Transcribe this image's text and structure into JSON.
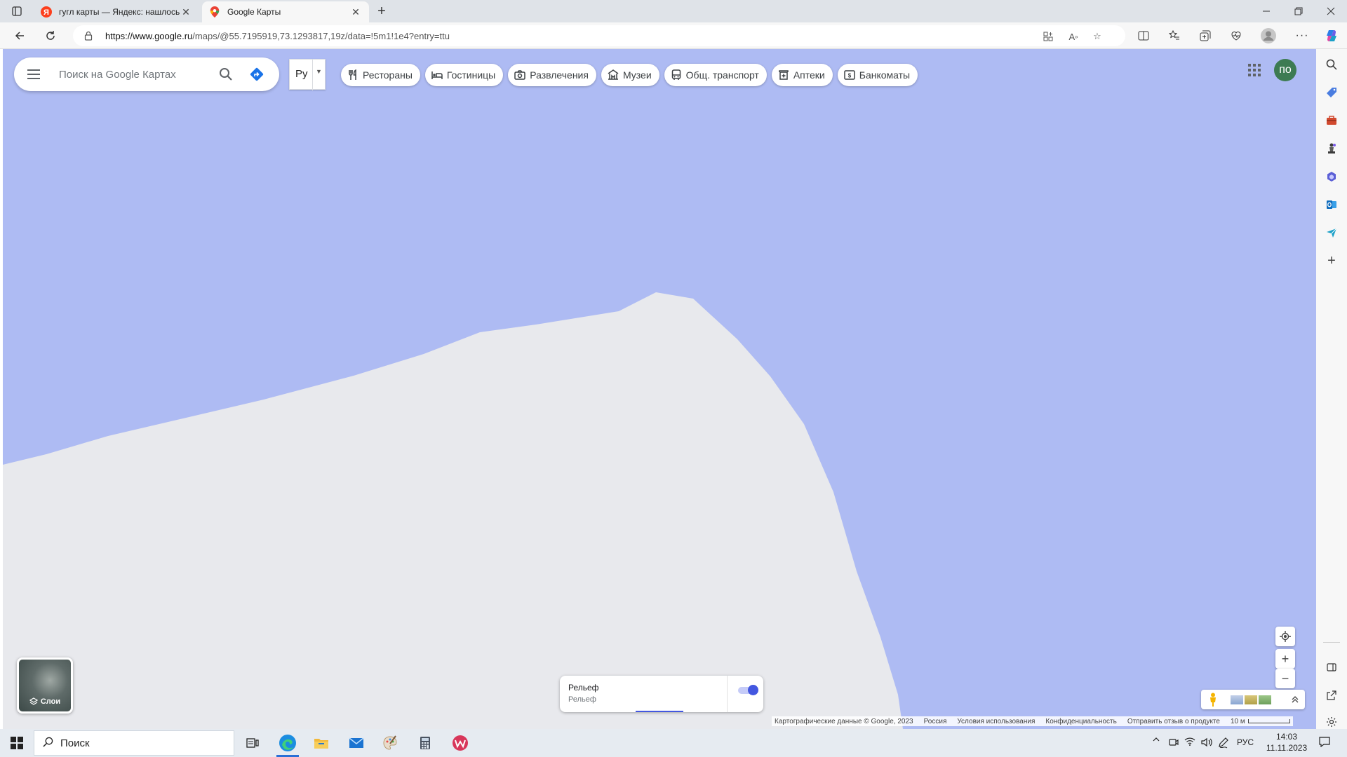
{
  "browser": {
    "tabs": [
      {
        "title": "гугл карты — Яндекс: нашлось",
        "active": false,
        "favicon": "yandex-icon"
      },
      {
        "title": "Google Карты",
        "active": true,
        "favicon": "google-maps-pin-icon"
      }
    ],
    "url_host": "https://www.google.ru",
    "url_path": "/maps/@55.7195919,73.1293817,19z/data=!5m1!1e4?entry=ttu"
  },
  "maps": {
    "search_placeholder": "Поиск на Google Картах",
    "lang_label": "Ру",
    "chips": [
      {
        "label": "Рестораны",
        "icon": "fork-knife-icon"
      },
      {
        "label": "Гостиницы",
        "icon": "bed-icon"
      },
      {
        "label": "Развлечения",
        "icon": "camera-icon"
      },
      {
        "label": "Музеи",
        "icon": "museum-icon"
      },
      {
        "label": "Общ. транспорт",
        "icon": "bus-icon"
      },
      {
        "label": "Аптеки",
        "icon": "pharmacy-icon"
      },
      {
        "label": "Банкоматы",
        "icon": "atm-icon"
      }
    ],
    "avatar_text": "по",
    "layers_label": "Слои",
    "relief": {
      "title": "Рельеф",
      "subtitle": "Рельеф",
      "enabled": true
    },
    "footer": {
      "data_credit": "Картографические данные © Google, 2023",
      "region": "Россия",
      "terms": "Условия использования",
      "privacy": "Конфиденциальность",
      "feedback": "Отправить отзыв о продукте",
      "scale": "10 м"
    },
    "colors": {
      "water": "#aebbf3",
      "land": "#e8e9ed",
      "accent": "#4357e0"
    }
  },
  "taskbar": {
    "search_placeholder": "Поиск",
    "lang": "РУС",
    "time": "14:03",
    "date": "11.11.2023"
  }
}
